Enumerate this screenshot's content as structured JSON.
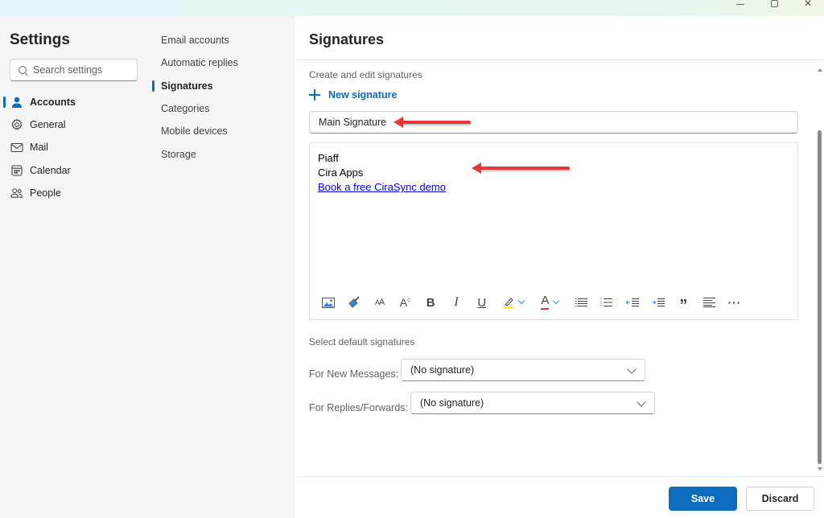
{
  "window": {
    "controls": [
      "minimize",
      "maximize",
      "close"
    ]
  },
  "settings_nav": {
    "title": "Settings",
    "search": {
      "placeholder": "Search settings",
      "value": ""
    },
    "items": [
      {
        "label": "Accounts",
        "icon": "person-icon",
        "active": true
      },
      {
        "label": "General",
        "icon": "gear-icon",
        "active": false
      },
      {
        "label": "Mail",
        "icon": "mail-icon",
        "active": false
      },
      {
        "label": "Calendar",
        "icon": "calendar-icon",
        "active": false
      },
      {
        "label": "People",
        "icon": "people-icon",
        "active": false
      }
    ]
  },
  "accounts_nav": {
    "items": [
      {
        "label": "Email accounts",
        "active": false
      },
      {
        "label": "Automatic replies",
        "active": false
      },
      {
        "label": "Signatures",
        "active": true
      },
      {
        "label": "Categories",
        "active": false
      },
      {
        "label": "Mobile devices",
        "active": false
      },
      {
        "label": "Storage",
        "active": false
      }
    ]
  },
  "main": {
    "title": "Signatures",
    "create_label": "Create and edit signatures",
    "new_signature_label": "New signature",
    "signature_name": "Main Signature",
    "signature_body": {
      "line1": "Piaff",
      "line2": "Cira Apps",
      "link_text": "Book a free CiraSync demo"
    },
    "toolbar": [
      "insert-picture-icon",
      "format-painter-icon",
      "font-size-icon",
      "increase-font-size-icon",
      "bold-icon",
      "italic-icon",
      "underline-icon",
      "highlight-color-icon",
      "font-color-icon",
      "bullets-icon",
      "numbering-icon",
      "decrease-indent-icon",
      "increase-indent-icon",
      "quote-icon",
      "align-icon",
      "more-options-icon"
    ],
    "toolbar_glyphs": {
      "font_size": "AA",
      "grow": "A",
      "bold": "B",
      "italic": "I",
      "underline": "U",
      "font_color": "A",
      "quote": "”",
      "more": "···"
    },
    "defaults_label": "Select default signatures",
    "new_messages": {
      "label": "For New Messages:",
      "value": "(No signature)"
    },
    "replies_forwards": {
      "label": "For Replies/Forwards:",
      "value": "(No signature)"
    },
    "save_label": "Save",
    "discard_label": "Discard"
  },
  "colors": {
    "accent": "#0f6cbd",
    "annotation_arrow": "#e8373b",
    "highlight": "#ffe600",
    "font_color": "#e8373b",
    "link": "#0000ee"
  }
}
